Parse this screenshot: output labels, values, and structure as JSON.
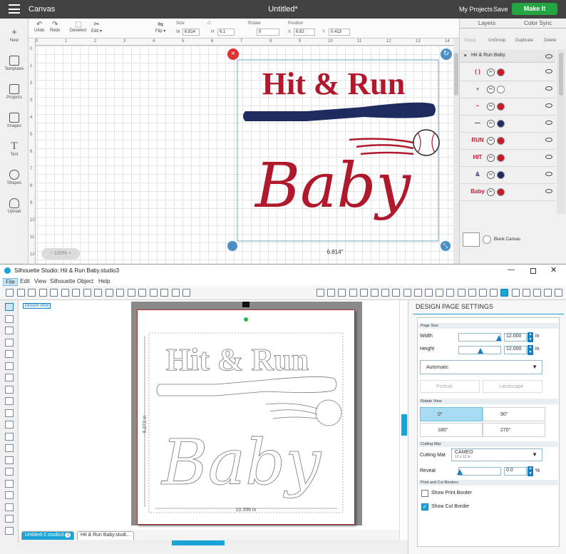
{
  "cricut": {
    "app_title": "Canvas",
    "document_title": "Untitled*",
    "my_projects": "My Projects",
    "save": "Save",
    "make_it": "Make It",
    "sidebar": [
      {
        "label": "New",
        "icon": "plus-icon"
      },
      {
        "label": "Templates",
        "icon": "shirt-icon"
      },
      {
        "label": "Projects",
        "icon": "projects-icon"
      },
      {
        "label": "Images",
        "icon": "image-icon"
      },
      {
        "label": "Text",
        "icon": "text-icon"
      },
      {
        "label": "Shapes",
        "icon": "shapes-icon"
      },
      {
        "label": "Upload",
        "icon": "upload-cloud-icon"
      }
    ],
    "toolbar": {
      "undo": "Undo",
      "redo": "Redo",
      "deselect": "Deselect",
      "edit": "Edit",
      "flip": "Flip",
      "size": "Size",
      "w_label": "W",
      "w_value": "6.814",
      "h_label": "H",
      "h_value": "6.1",
      "rotate": "Rotate",
      "rotate_value": "0",
      "position": "Position",
      "x_label": "X",
      "x_value": "6.82",
      "y_label": "Y",
      "y_value": "0.413"
    },
    "ruler_top": [
      "0",
      "1",
      "2",
      "3",
      "4",
      "5",
      "6",
      "7",
      "8",
      "9",
      "10",
      "11",
      "12",
      "13",
      "14"
    ],
    "ruler_left": [
      "0",
      "1",
      "2",
      "3",
      "4",
      "5",
      "6",
      "7",
      "8",
      "9",
      "10",
      "11",
      "12"
    ],
    "design": {
      "line1": "Hit & Run",
      "line2": "Baby",
      "width_label": "6.814\""
    },
    "zoom": "100%",
    "panel": {
      "tab_layers": "Layers",
      "tab_color_sync": "Color Sync",
      "group": "Group",
      "ungroup": "UnGroup",
      "duplicate": "Duplicate",
      "delete": "Delete",
      "group_name": "Hit & Run Baby",
      "blank_canvas": "Blank Canvas",
      "layers": [
        {
          "thumb": "(  )",
          "color": "#c8192e"
        },
        {
          "thumb": "●",
          "color": "#ffffff"
        },
        {
          "thumb": "~",
          "color": "#c8192e"
        },
        {
          "thumb": "—",
          "color": "#1d2b5e"
        },
        {
          "thumb": "RUN",
          "color": "#c8192e"
        },
        {
          "thumb": "HIT",
          "color": "#c8192e"
        },
        {
          "thumb": "&",
          "color": "#1d2b5e"
        },
        {
          "thumb": "Baby",
          "color": "#c8192e"
        }
      ]
    }
  },
  "silhouette": {
    "window_title": "Silhouette Studio: Hit & Run Baby.studio3",
    "menu": [
      "File",
      "Edit",
      "View",
      "Silhouette",
      "Object",
      "Help"
    ],
    "design_view": "DESIGN VIEW",
    "design": {
      "line1": "Hit & Run",
      "line2": "Baby",
      "width_dim": "10.356 in",
      "height_dim": "9.272 in"
    },
    "tabs": [
      {
        "label": "Untitled-2.studio3",
        "badge": "1"
      },
      {
        "label": "Hit & Run Baby.studi...",
        "badge": ""
      }
    ],
    "panel": {
      "title": "DESIGN PAGE SETTINGS",
      "page_size": "Page Size",
      "width_label": "Width",
      "width_value": "12.000",
      "width_unit": "in",
      "height_label": "Height",
      "height_value": "12.000",
      "height_unit": "in",
      "paper_select": "Automatic",
      "portrait": "Portrait",
      "landscape": "Landscape",
      "rotate_view": "Rotate View",
      "rot0": "0°",
      "rot90": "90°",
      "rot180": "180°",
      "rot270": "270°",
      "cutting_mat_header": "Cutting Mat",
      "cutting_mat_label": "Cutting Mat",
      "cutting_mat_value": "CAMEO",
      "cutting_mat_sub": "12 x 12 in",
      "reveal_label": "Reveal",
      "reveal_value": "0.0",
      "reveal_unit": "%",
      "print_cut_header": "Print and Cut Borders",
      "show_print_border": "Show Print Border",
      "show_cut_border": "Show Cut Border"
    }
  },
  "colors": {
    "red": "#b0192c",
    "navy": "#1d2b5e",
    "cricut_green": "#25a442",
    "silhouette_blue": "#1aa3d6"
  }
}
